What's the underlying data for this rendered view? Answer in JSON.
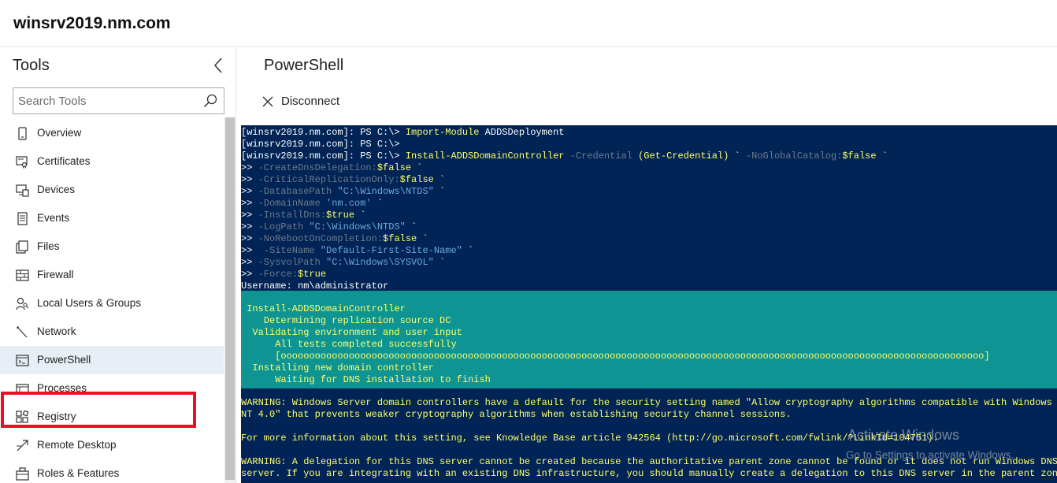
{
  "header": {
    "server_name": "winsrv2019.nm.com"
  },
  "sidebar": {
    "title": "Tools",
    "search_placeholder": "Search Tools",
    "items": [
      {
        "label": "Overview",
        "icon": "device-icon"
      },
      {
        "label": "Certificates",
        "icon": "certificate-icon"
      },
      {
        "label": "Devices",
        "icon": "devices-icon"
      },
      {
        "label": "Events",
        "icon": "events-icon"
      },
      {
        "label": "Files",
        "icon": "files-icon"
      },
      {
        "label": "Firewall",
        "icon": "firewall-icon"
      },
      {
        "label": "Local Users & Groups",
        "icon": "users-icon"
      },
      {
        "label": "Network",
        "icon": "network-icon"
      },
      {
        "label": "PowerShell",
        "icon": "powershell-icon",
        "selected": true
      },
      {
        "label": "Processes",
        "icon": "processes-icon"
      },
      {
        "label": "Registry",
        "icon": "registry-icon"
      },
      {
        "label": "Remote Desktop",
        "icon": "remote-desktop-icon"
      },
      {
        "label": "Roles & Features",
        "icon": "roles-icon"
      }
    ]
  },
  "main": {
    "title": "PowerShell",
    "disconnect_label": "Disconnect",
    "console": {
      "l1_prompt": "[winsrv2019.nm.com]: PS C:\\> ",
      "l1_cmd": "Import-Module",
      "l1_arg": " ADDSDeployment",
      "l2": "[winsrv2019.nm.com]: PS C:\\>",
      "l3_prompt": "[winsrv2019.nm.com]: PS C:\\> ",
      "l3_cmd": "Install-ADDSDomainController",
      "l3_p1": " -Credential ",
      "l3_p2": "(Get-Credential)",
      "l3_p3": " ` ",
      "l3_p4": "-NoGlobalCatalog:",
      "l3_p5": "$false",
      "l3_p6": " `",
      "params": [
        {
          "pre": ">> ",
          "name": "-CreateDnsDelegation:",
          "val": "$false",
          "post": " `"
        },
        {
          "pre": ">> ",
          "name": "-CriticalReplicationOnly:",
          "val": "$false",
          "post": " `"
        },
        {
          "pre": ">> ",
          "name": "-DatabasePath ",
          "val": "\"C:\\Windows\\NTDS\"",
          "post": " `"
        },
        {
          "pre": ">> ",
          "name": "-DomainName ",
          "val": "'nm.com'",
          "post": " `"
        },
        {
          "pre": ">> ",
          "name": "-InstallDns:",
          "val": "$true",
          "post": " `"
        },
        {
          "pre": ">> ",
          "name": "-LogPath ",
          "val": "\"C:\\Windows\\NTDS\"",
          "post": " `"
        },
        {
          "pre": ">> ",
          "name": "-NoRebootOnCompletion:",
          "val": "$false",
          "post": " `"
        },
        {
          "pre": ">>  ",
          "name": "-SiteName ",
          "val": "\"Default-First-Site-Name\"",
          "post": " `"
        },
        {
          "pre": ">> ",
          "name": "-SysvolPath ",
          "val": "\"C:\\Windows\\SYSVOL\"",
          "post": " `"
        },
        {
          "pre": ">> ",
          "name": "-Force:",
          "val": "$true",
          "post": ""
        }
      ],
      "username": "Username: nm\\administrator",
      "progress": [
        " Install-ADDSDomainController",
        "    Determining replication source DC",
        "  Validating environment and user input",
        "      All tests completed successfully",
        "      [oooooooooooooooooooooooooooooooooooooooooooooooooooooooooooooooooooooooooooooooooooooooooooooooooooooooooooooooooooooooooooo]",
        "  Installing new domain controller",
        "      Waiting for DNS installation to finish"
      ],
      "warn1": "WARNING: Windows Server domain controllers have a default for the security setting named \"Allow cryptography algorithms compatible with Windows",
      "warn1b": "NT 4.0\" that prevents weaker cryptography algorithms when establishing security channel sessions.",
      "info": "For more information about this setting, see Knowledge Base article 942564 (http://go.microsoft.com/fwlink/?LinkId=104751).",
      "warn2": "WARNING: A delegation for this DNS server cannot be created because the authoritative parent zone cannot be found or it does not run Windows DNS",
      "warn2b": "server. If you are integrating with an existing DNS infrastructure, you should manually create a delegation to this DNS server in the parent zone"
    },
    "watermark_title": "Activate Windows",
    "watermark_sub": "Go to Settings to activate Windows."
  }
}
